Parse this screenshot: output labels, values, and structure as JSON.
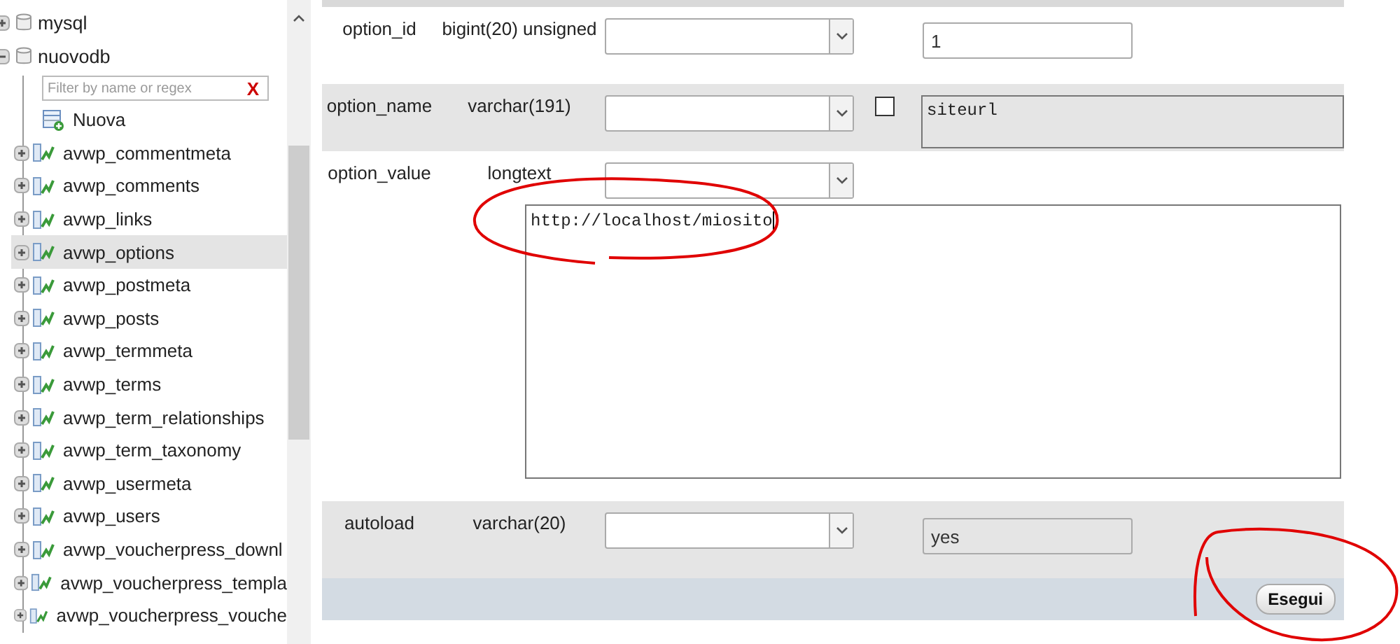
{
  "sidebar": {
    "databases": [
      {
        "name": "mysql",
        "expanded": false
      },
      {
        "name": "nuovodb",
        "expanded": true,
        "filter": {
          "placeholder": "Filter by name or regex",
          "clear": "X"
        },
        "children": [
          {
            "name": "Nuova",
            "kind": "new",
            "selected": false
          },
          {
            "name": "avwp_commentmeta",
            "kind": "table",
            "selected": false
          },
          {
            "name": "avwp_comments",
            "kind": "table",
            "selected": false
          },
          {
            "name": "avwp_links",
            "kind": "table",
            "selected": false
          },
          {
            "name": "avwp_options",
            "kind": "table",
            "selected": true
          },
          {
            "name": "avwp_postmeta",
            "kind": "table",
            "selected": false
          },
          {
            "name": "avwp_posts",
            "kind": "table",
            "selected": false
          },
          {
            "name": "avwp_termmeta",
            "kind": "table",
            "selected": false
          },
          {
            "name": "avwp_terms",
            "kind": "table",
            "selected": false
          },
          {
            "name": "avwp_term_relationships",
            "kind": "table",
            "selected": false
          },
          {
            "name": "avwp_term_taxonomy",
            "kind": "table",
            "selected": false
          },
          {
            "name": "avwp_usermeta",
            "kind": "table",
            "selected": false
          },
          {
            "name": "avwp_users",
            "kind": "table",
            "selected": false
          },
          {
            "name": "avwp_voucherpress_downl",
            "kind": "table",
            "selected": false
          },
          {
            "name": "avwp_voucherpress_templa",
            "kind": "table",
            "selected": false
          },
          {
            "name": "avwp_voucherpress_vouche",
            "kind": "table",
            "selected": false
          }
        ]
      }
    ]
  },
  "form": {
    "rows": [
      {
        "column": "option_id",
        "type": "bigint(20) unsigned",
        "kind": "input",
        "value": "1"
      },
      {
        "column": "option_name",
        "type": "varchar(191)",
        "kind": "textarea",
        "value": "siteurl",
        "null": {
          "checked": false
        }
      },
      {
        "column": "option_value",
        "type": "longtext",
        "kind": "bigtext",
        "value": "http://localhost/miosito"
      },
      {
        "column": "autoload",
        "type": "varchar(20)",
        "kind": "input",
        "value": "yes"
      }
    ],
    "submit": "Esegui"
  }
}
